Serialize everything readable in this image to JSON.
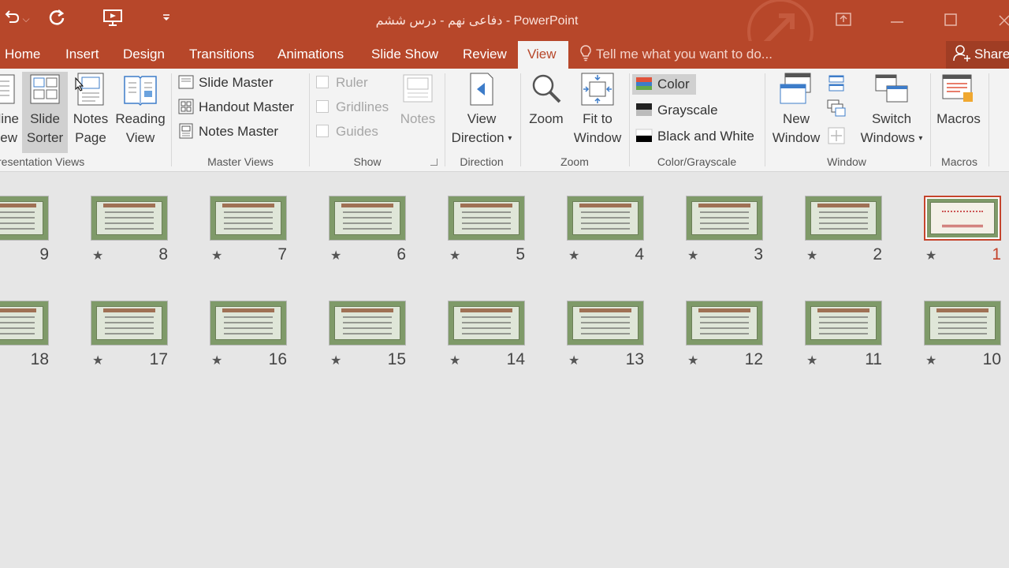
{
  "window": {
    "title": "دفاعی نهم - درس ششم - PowerPoint"
  },
  "qat": {
    "dropdown_symbol": "⌵"
  },
  "tabs": [
    {
      "label": "Home"
    },
    {
      "label": "Insert"
    },
    {
      "label": "Design"
    },
    {
      "label": "Transitions"
    },
    {
      "label": "Animations"
    },
    {
      "label": "Slide Show"
    },
    {
      "label": "Review"
    },
    {
      "label": "View"
    }
  ],
  "tell_me": "Tell me what you want to do...",
  "share": "Share",
  "ribbon": {
    "presentation_views": {
      "label": "resentation Views",
      "outline_line1": "line",
      "outline_line2": "ew",
      "slide_sorter_line1": "Slide",
      "slide_sorter_line2": "Sorter",
      "notes_page_line1": "Notes",
      "notes_page_line2": "Page",
      "reading_view_line1": "Reading",
      "reading_view_line2": "View"
    },
    "master_views": {
      "label": "Master Views",
      "slide_master": "Slide Master",
      "handout_master": "Handout Master",
      "notes_master": "Notes Master"
    },
    "show": {
      "label": "Show",
      "ruler": "Ruler",
      "gridlines": "Gridlines",
      "guides": "Guides",
      "notes": "Notes"
    },
    "direction": {
      "label": "Direction",
      "view_direction_line1": "View",
      "view_direction_line2": "Direction"
    },
    "zoom": {
      "label": "Zoom",
      "zoom": "Zoom",
      "fit_line1": "Fit to",
      "fit_line2": "Window"
    },
    "color": {
      "label": "Color/Grayscale",
      "color": "Color",
      "grayscale": "Grayscale",
      "bw": "Black and White"
    },
    "window": {
      "label": "Window",
      "new_window_line1": "New",
      "new_window_line2": "Window",
      "switch_line1": "Switch",
      "switch_line2": "Windows"
    },
    "macros": {
      "label": "Macros",
      "macros": "Macros"
    }
  },
  "slides_row1": [
    "9",
    "8",
    "7",
    "6",
    "5",
    "4",
    "3",
    "2",
    "1"
  ],
  "slides_row2": [
    "18",
    "17",
    "16",
    "15",
    "14",
    "13",
    "12",
    "11",
    "10"
  ],
  "selected_slide": "1",
  "star_symbol": "★",
  "colors": {
    "accent": "#b7472a",
    "selection": "#c5442c",
    "ribbon_bg": "#f3f3f3",
    "workspace_bg": "#e6e6e6"
  }
}
